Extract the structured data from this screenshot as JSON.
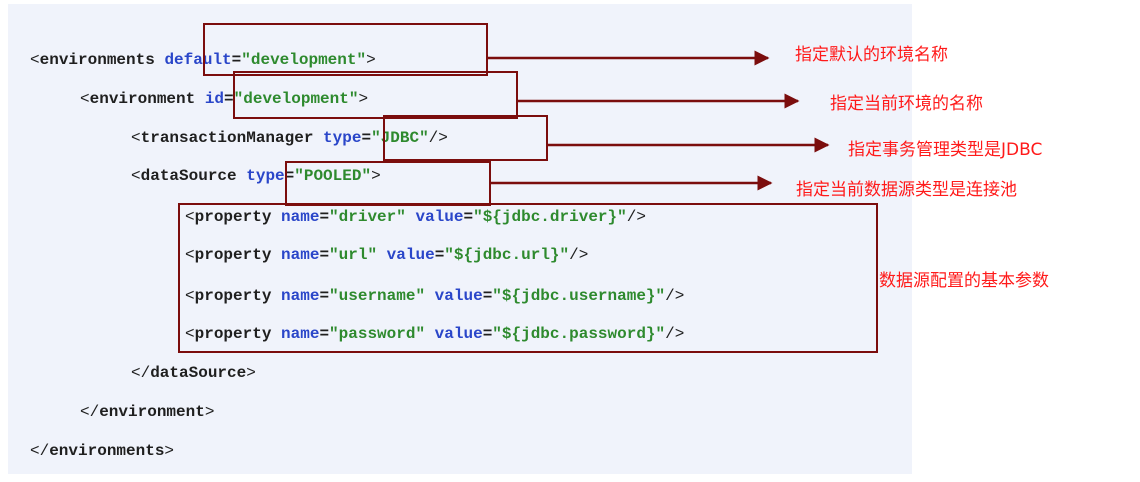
{
  "code": {
    "lines": [
      [
        {
          "t": "<",
          "c": "br"
        },
        {
          "t": "environments ",
          "c": "tag"
        },
        {
          "t": "default",
          "c": "attr"
        },
        {
          "t": "=",
          "c": "eq"
        },
        {
          "t": "\"development\"",
          "c": "val"
        },
        {
          "t": ">",
          "c": "br"
        }
      ],
      [
        {
          "t": "<",
          "c": "br"
        },
        {
          "t": "environment ",
          "c": "tag"
        },
        {
          "t": "id",
          "c": "attr"
        },
        {
          "t": "=",
          "c": "eq"
        },
        {
          "t": "\"development\"",
          "c": "val"
        },
        {
          "t": ">",
          "c": "br"
        }
      ],
      [
        {
          "t": "<",
          "c": "br"
        },
        {
          "t": "transactionManager ",
          "c": "tag"
        },
        {
          "t": "type",
          "c": "attr"
        },
        {
          "t": "=",
          "c": "eq"
        },
        {
          "t": "\"JDBC\"",
          "c": "val"
        },
        {
          "t": "/>",
          "c": "br"
        }
      ],
      [
        {
          "t": "<",
          "c": "br"
        },
        {
          "t": "dataSource ",
          "c": "tag"
        },
        {
          "t": "type",
          "c": "attr"
        },
        {
          "t": "=",
          "c": "eq"
        },
        {
          "t": "\"POOLED\"",
          "c": "val"
        },
        {
          "t": ">",
          "c": "br"
        }
      ],
      [
        {
          "t": "<",
          "c": "br"
        },
        {
          "t": "property ",
          "c": "tag"
        },
        {
          "t": "name",
          "c": "attr"
        },
        {
          "t": "=",
          "c": "eq"
        },
        {
          "t": "\"driver\"",
          "c": "val"
        },
        {
          "t": " ",
          "c": "eq"
        },
        {
          "t": "value",
          "c": "attr"
        },
        {
          "t": "=",
          "c": "eq"
        },
        {
          "t": "\"${jdbc.driver}\"",
          "c": "val"
        },
        {
          "t": "/>",
          "c": "br"
        }
      ],
      [
        {
          "t": "<",
          "c": "br"
        },
        {
          "t": "property ",
          "c": "tag"
        },
        {
          "t": "name",
          "c": "attr"
        },
        {
          "t": "=",
          "c": "eq"
        },
        {
          "t": "\"url\"",
          "c": "val"
        },
        {
          "t": " ",
          "c": "eq"
        },
        {
          "t": "value",
          "c": "attr"
        },
        {
          "t": "=",
          "c": "eq"
        },
        {
          "t": "\"${jdbc.url}\"",
          "c": "val"
        },
        {
          "t": "/>",
          "c": "br"
        }
      ],
      [
        {
          "t": "<",
          "c": "br"
        },
        {
          "t": "property ",
          "c": "tag"
        },
        {
          "t": "name",
          "c": "attr"
        },
        {
          "t": "=",
          "c": "eq"
        },
        {
          "t": "\"username\"",
          "c": "val"
        },
        {
          "t": " ",
          "c": "eq"
        },
        {
          "t": "value",
          "c": "attr"
        },
        {
          "t": "=",
          "c": "eq"
        },
        {
          "t": "\"${jdbc.username}\"",
          "c": "val"
        },
        {
          "t": "/>",
          "c": "br"
        }
      ],
      [
        {
          "t": "<",
          "c": "br"
        },
        {
          "t": "property ",
          "c": "tag"
        },
        {
          "t": "name",
          "c": "attr"
        },
        {
          "t": "=",
          "c": "eq"
        },
        {
          "t": "\"password\"",
          "c": "val"
        },
        {
          "t": " ",
          "c": "eq"
        },
        {
          "t": "value",
          "c": "attr"
        },
        {
          "t": "=",
          "c": "eq"
        },
        {
          "t": "\"${jdbc.password}\"",
          "c": "val"
        },
        {
          "t": "/>",
          "c": "br"
        }
      ],
      [
        {
          "t": "</",
          "c": "br"
        },
        {
          "t": "dataSource",
          "c": "tag"
        },
        {
          "t": ">",
          "c": "br"
        }
      ],
      [
        {
          "t": "</",
          "c": "br"
        },
        {
          "t": "environment",
          "c": "tag"
        },
        {
          "t": ">",
          "c": "br"
        }
      ],
      [
        {
          "t": "</",
          "c": "br"
        },
        {
          "t": "environments",
          "c": "tag"
        },
        {
          "t": ">",
          "c": "br"
        }
      ]
    ]
  },
  "annotations": {
    "default_env": "指定默认的环境名称",
    "current_env": "指定当前环境的名称",
    "tx_type": "指定事务管理类型是JDBC",
    "ds_type": "指定当前数据源类型是连接池",
    "ds_params": "数据源配置的基本参数"
  },
  "colors": {
    "panel": "#f0f3fb",
    "box": "#7b0d0d",
    "arrow": "#7b0d0d",
    "note": "#ff1a1a",
    "tag": "#1f1f1f",
    "attr": "#2a46c9",
    "value": "#2e8a2e"
  }
}
